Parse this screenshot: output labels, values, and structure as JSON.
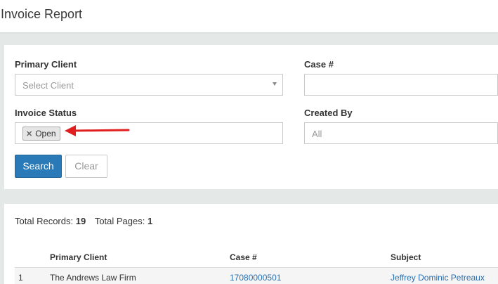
{
  "header": {
    "title": "Invoice Report"
  },
  "filters": {
    "primary_client": {
      "label": "Primary Client",
      "placeholder": "Select Client"
    },
    "case_number": {
      "label": "Case #",
      "value": ""
    },
    "invoice_status": {
      "label": "Invoice Status",
      "tags": [
        "Open"
      ]
    },
    "created_by": {
      "label": "Created By",
      "placeholder": "All"
    },
    "search_label": "Search",
    "clear_label": "Clear"
  },
  "annotation": {
    "arrow_color": "#e02020"
  },
  "results": {
    "total_records_label": "Total Records:",
    "total_records": "19",
    "total_pages_label": "Total Pages:",
    "total_pages": "1",
    "columns": [
      "",
      "Primary Client",
      "Case #",
      "Subject"
    ],
    "rows": [
      {
        "num": "1",
        "client": "The Andrews Law Firm",
        "case": "17080000501",
        "subject": "Jeffrey Dominic Petreaux"
      }
    ]
  },
  "colors": {
    "primary": "#2a7ab7",
    "link": "#2a6fb0",
    "background": "#e4e8e6"
  }
}
